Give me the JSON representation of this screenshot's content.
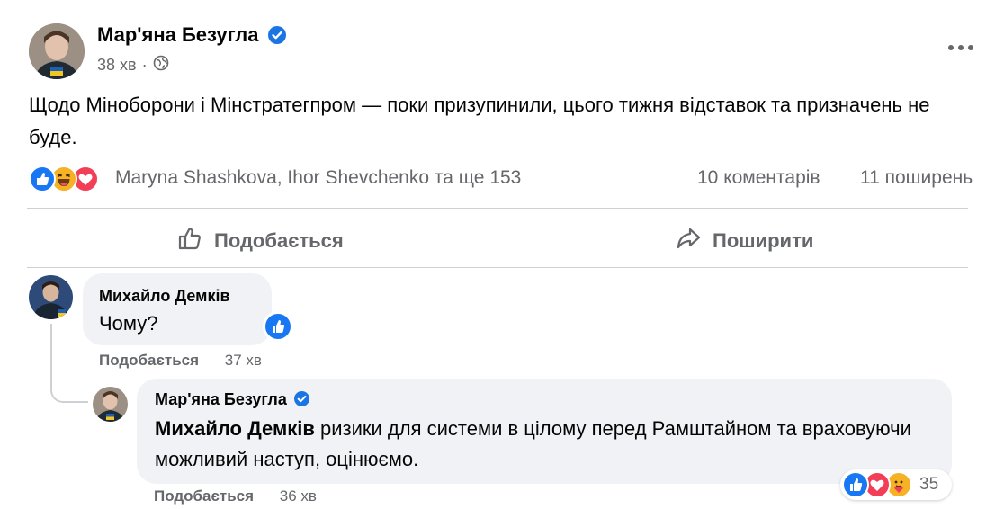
{
  "post": {
    "author": "Мар'яна Безугла",
    "time": "38 хв",
    "text": "Щодо Міноборони і Мінстратегпром — поки призупинили, цього тижня відставок та призначень не буде.",
    "reactors": "Maryna Shashkova, Ihor Shevchenko та ще 153",
    "comments_count": "10 коментарів",
    "shares_count": "11 поширень",
    "reaction_icons": [
      "like-icon",
      "haha-icon",
      "love-icon"
    ]
  },
  "actions": {
    "like_label": "Подобається",
    "share_label": "Поширити"
  },
  "comments": [
    {
      "author": "Михайло Демків",
      "text": "Чому?",
      "like_label": "Подобається",
      "time": "37 хв"
    }
  ],
  "reply": {
    "author": "Мар'яна Безугла",
    "mention": "Михайло Демків",
    "text": " ризики для системи в цілому перед Рамштайном та враховуючи можливий наступ, оцінюємо.",
    "like_label": "Подобається",
    "time": "36 хв",
    "reaction_count": "35"
  },
  "colors": {
    "verified_blue": "#1b74e4",
    "like_blue": "#1877f2",
    "love_red": "#f33e58",
    "haha_yellow": "#f7b125",
    "secondary_text": "#65676b"
  }
}
